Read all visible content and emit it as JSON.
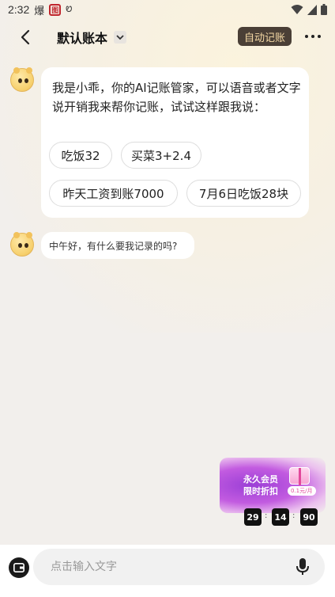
{
  "status_bar": {
    "time": "2:32",
    "notif1": "爆",
    "notif2": "图",
    "notif3": "Ꮼ"
  },
  "header": {
    "title": "默认账本",
    "auto_button": "自动记账"
  },
  "assistant": {
    "intro": "我是小乖，你的AI记账管家，可以语音或者文字说开销我来帮你记账，试试这样跟我说：",
    "chips": [
      "吃饭32",
      "买菜3+2.4",
      "昨天工资到账7000",
      "7月6日吃饭28块"
    ],
    "greeting": "中午好，有什么要我记录的吗?"
  },
  "promo": {
    "line1": "永久会员",
    "line2": "限时折扣",
    "price": "0.1元/月",
    "timer": [
      "29",
      "14",
      "90"
    ]
  },
  "input": {
    "placeholder": "点击输入文字"
  },
  "colors": {
    "auto_button_bg": "#4a3f36",
    "auto_button_text": "#f5d9a5",
    "promo_purple": "#9b3fd6"
  },
  "icons": [
    "back-arrow-icon",
    "chevron-down-icon",
    "more-icon",
    "wallet-icon",
    "mic-icon",
    "wifi-icon",
    "signal-icon",
    "battery-icon"
  ]
}
